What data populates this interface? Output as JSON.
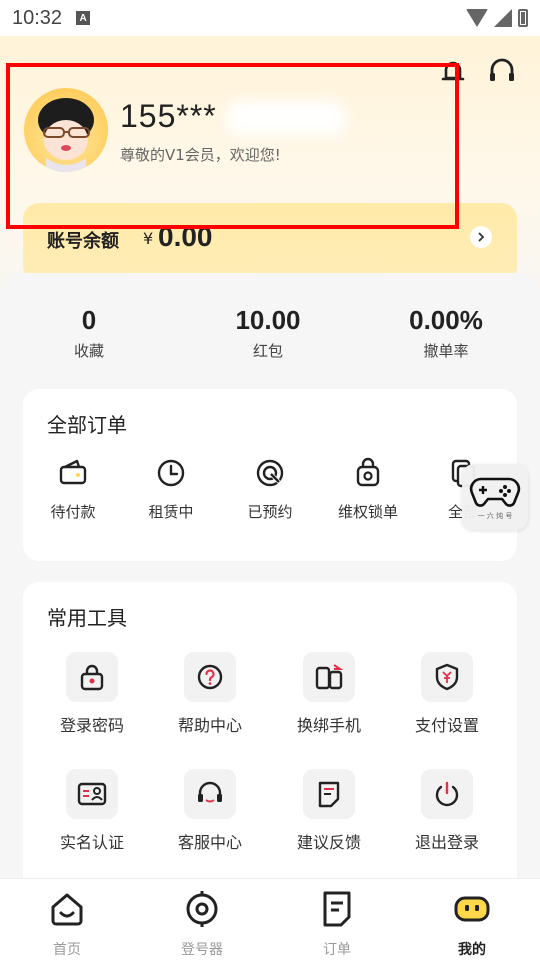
{
  "status_bar": {
    "time": "10:32",
    "badge": "A"
  },
  "header": {
    "username": "155***",
    "welcome": "尊敬的V1会员，欢迎您!",
    "balance_label": "账号余额",
    "balance_currency": "¥",
    "balance_value": "0.00",
    "icons": [
      "bell-icon",
      "headset-icon",
      "chevron-right-icon"
    ]
  },
  "stats": [
    {
      "value": "0",
      "label": "收藏"
    },
    {
      "value": "10.00",
      "label": "红包"
    },
    {
      "value": "0.00%",
      "label": "撤单率"
    }
  ],
  "orders": {
    "title": "全部订单",
    "items": [
      {
        "label": "待付款",
        "icon": "wallet-icon"
      },
      {
        "label": "租赁中",
        "icon": "clock-icon"
      },
      {
        "label": "已预约",
        "icon": "target-icon"
      },
      {
        "label": "维权锁单",
        "icon": "lock-bag-icon"
      },
      {
        "label": "全部",
        "icon": "copy-icon"
      }
    ]
  },
  "tools": {
    "title": "常用工具",
    "items": [
      {
        "label": "登录密码",
        "icon": "lock-icon"
      },
      {
        "label": "帮助中心",
        "icon": "help-icon"
      },
      {
        "label": "换绑手机",
        "icon": "phone-switch-icon"
      },
      {
        "label": "支付设置",
        "icon": "shield-yen-icon"
      },
      {
        "label": "实名认证",
        "icon": "id-card-icon"
      },
      {
        "label": "客服中心",
        "icon": "headset-icon"
      },
      {
        "label": "建议反馈",
        "icon": "feedback-icon"
      },
      {
        "label": "退出登录",
        "icon": "power-icon"
      }
    ]
  },
  "floating": {
    "label": "一 六 炖 号",
    "icon": "gamepad-icon"
  },
  "bottom_nav": [
    {
      "label": "首页",
      "icon": "home-icon",
      "active": false
    },
    {
      "label": "登号器",
      "icon": "login-tool-icon",
      "active": false
    },
    {
      "label": "订单",
      "icon": "order-icon",
      "active": false
    },
    {
      "label": "我的",
      "icon": "profile-icon",
      "active": true
    }
  ],
  "colors": {
    "accent": "#ffd84a",
    "highlight": "#ff0000",
    "header_bg": "#fff3d8",
    "balance_card": "#ffeaa8"
  }
}
